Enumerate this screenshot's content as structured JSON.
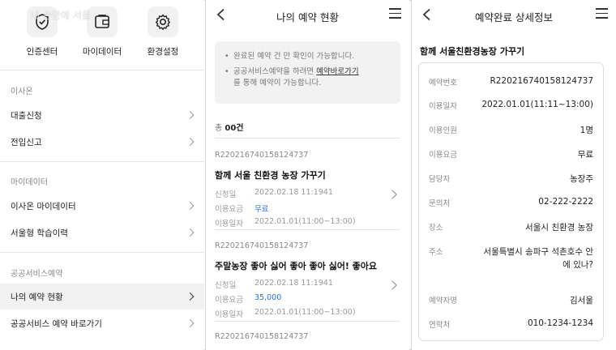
{
  "watermark": "내 손안에 서울",
  "panel1": {
    "icons": [
      {
        "label": "인증센터",
        "icon": "shield-check-icon"
      },
      {
        "label": "마이데이터",
        "icon": "wallet-icon"
      },
      {
        "label": "환경설정",
        "icon": "gear-icon"
      }
    ],
    "sections": [
      {
        "label": "이사온",
        "items": [
          "대출신청",
          "전입신고"
        ]
      },
      {
        "label": "마이데이터",
        "items": [
          "이사온 마이데이터",
          "서울형 학습이력"
        ]
      },
      {
        "label": "공공서비스예약",
        "items": [
          "나의 예약 현황",
          "공공서비스 예약 바로가기"
        ]
      }
    ],
    "active_item": "나의 예약 현황"
  },
  "panel2": {
    "title": "나의 예약 현황",
    "notice": {
      "line1": "완료된 예약 건 만 확인이 가능합니다.",
      "line2_pre": "공공서비스예약을 하려면 ",
      "line2_link": "예약바로가기",
      "line2_post": "를 통해 예약이 가능합니다."
    },
    "total_prefix": "총 ",
    "total_count": "00건",
    "labels": {
      "applied": "신청일",
      "fee": "이용요금",
      "use_date": "이용일자"
    },
    "reservations": [
      {
        "id": "R220216740158124737",
        "title": "함께 서울 친환경 농장 가꾸기",
        "applied": "2022.02.18 11:1941",
        "fee": "무료",
        "use_date": "2022.01.01(11:00~13:00)"
      },
      {
        "id": "R220216740158124737",
        "title": "주말농장 좋아 싫어 좋아 좋아 싫어! 좋아요",
        "applied": "2022.02.18 11:1941",
        "fee": "35,000",
        "use_date": "2022.01.01(11:00~13:00)"
      },
      {
        "id": "R220216740158124737"
      }
    ]
  },
  "panel3": {
    "title": "예약완료 상세정보",
    "place": "함께 서울친환경농장 가꾸기",
    "details": [
      {
        "key": "예약번호",
        "value": "R220216740158124737"
      },
      {
        "key": "이용일자",
        "value": "2022.01.01(11:11~13:00)"
      },
      {
        "key": "이용인원",
        "value": "1명"
      },
      {
        "key": "이용요금",
        "value": "무료"
      },
      {
        "key": "담당자",
        "value": "농장주"
      },
      {
        "key": "문의처",
        "value": "02-222-2222"
      },
      {
        "key": "장소",
        "value": "서울시 친환경 농장"
      },
      {
        "key": "주소",
        "value": "서울특별시 송파구 석촌호수 안에 있나?"
      },
      {
        "key": "예약자명",
        "value": "김서울"
      },
      {
        "key": "연락처",
        "value": "010-1234-1234"
      }
    ]
  }
}
